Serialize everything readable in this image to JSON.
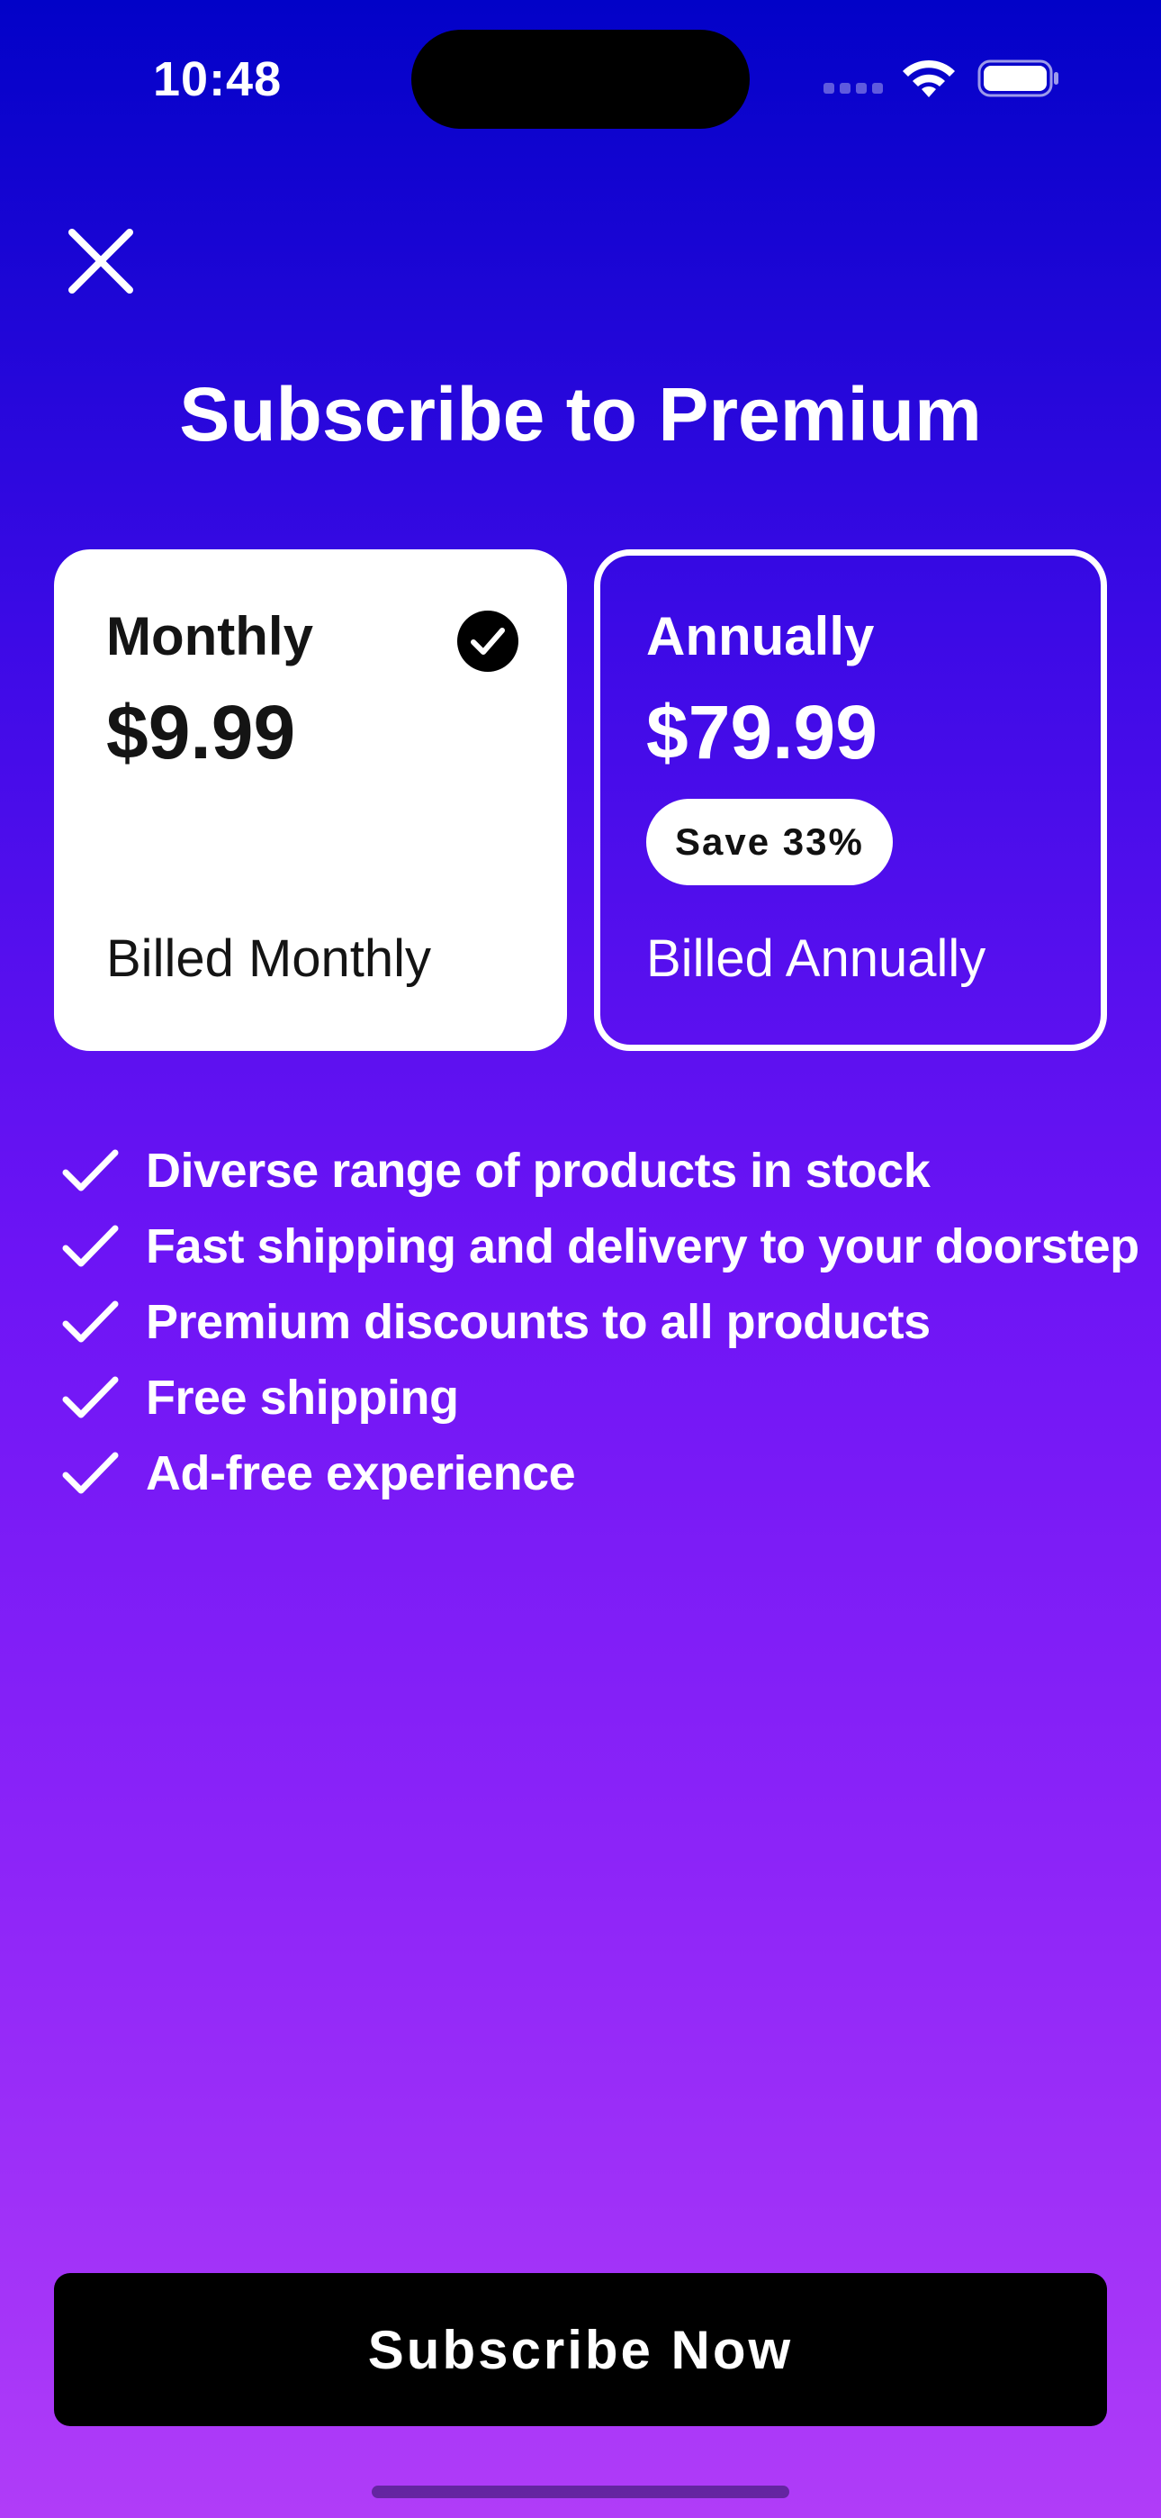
{
  "status_bar": {
    "time": "10:48"
  },
  "header": {
    "close_icon": "close-icon",
    "title": "Subscribe to Premium"
  },
  "plans": [
    {
      "name": "Monthly",
      "price": "$9.99",
      "billing": "Billed Monthly",
      "selected": true,
      "selected_icon": "checkmark-circle-icon"
    },
    {
      "name": "Annually",
      "price": "$79.99",
      "badge": "Save 33%",
      "billing": "Billed Annually",
      "selected": false
    }
  ],
  "features": [
    "Diverse range of products in stock",
    "Fast shipping and delivery to your doorstep",
    "Premium discounts to all products",
    "Free shipping",
    "Ad-free experience"
  ],
  "cta": {
    "label": "Subscribe Now"
  },
  "colors": {
    "gradient_top": "#0202c8",
    "gradient_bottom": "#b03cf8",
    "card_selected_bg": "#ffffff",
    "button_bg": "#000000"
  }
}
